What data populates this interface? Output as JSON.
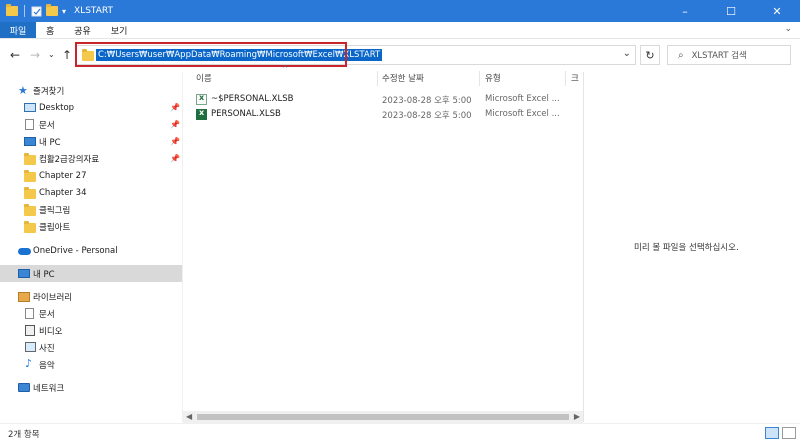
{
  "window": {
    "title": "XLSTART",
    "minimize": "–",
    "maximize": "☐",
    "close": "✕"
  },
  "ribbon": {
    "tabs": [
      "파일",
      "홈",
      "공유",
      "보기"
    ],
    "expand": "⌄"
  },
  "address": {
    "path": "C:₩Users₩user₩AppData₩Roaming₩Microsoft₩Excel₩XLSTART",
    "dropdown": "⌄",
    "refresh": "↻",
    "back": "←",
    "forward": "→",
    "recent": "⌄",
    "up": "↑"
  },
  "search": {
    "icon": "⌕",
    "placeholder": "XLSTART 검색"
  },
  "nav": {
    "quick_access": "즐겨찾기",
    "items_quick": [
      {
        "label": "Desktop",
        "icon": "desktop-icon",
        "pinned": true
      },
      {
        "label": "문서",
        "icon": "document-icon",
        "pinned": true
      },
      {
        "label": "내 PC",
        "icon": "pc-icon",
        "pinned": true
      },
      {
        "label": "컴활2급강의자료",
        "icon": "folder-icon",
        "pinned": true
      },
      {
        "label": "Chapter 27",
        "icon": "folder-icon",
        "pinned": false
      },
      {
        "label": "Chapter 34",
        "icon": "folder-icon",
        "pinned": false
      },
      {
        "label": "클릭그림",
        "icon": "folder-icon",
        "pinned": false
      },
      {
        "label": "클립아트",
        "icon": "folder-icon",
        "pinned": false
      }
    ],
    "onedrive": "OneDrive - Personal",
    "this_pc": "내 PC",
    "library": "라이브러리",
    "library_items": [
      "문서",
      "비디오",
      "사진",
      "음악"
    ],
    "network": "네트워크",
    "pin_glyph": "📌"
  },
  "columns": {
    "name": "이름",
    "modified": "수정한 날짜",
    "type": "유형",
    "size": "크",
    "sort_indicator": "^"
  },
  "files": [
    {
      "name": "~$PERSONAL.XLSB",
      "modified": "2023-08-28 오후 5:00",
      "type": "Microsoft Excel ..."
    },
    {
      "name": "PERSONAL.XLSB",
      "modified": "2023-08-28 오후 5:00",
      "type": "Microsoft Excel ..."
    }
  ],
  "preview": {
    "message": "미리 볼 파일을 선택하십시오."
  },
  "scroll": {
    "left": "◀",
    "right": "▶"
  },
  "status": {
    "count": "2개 항목"
  },
  "colors": {
    "titlebar": "#2a78d7",
    "file_tab": "#1f6fc5",
    "address_selection": "#0a66c9",
    "highlight_box": "#c7242b",
    "selected_nav": "#d9d9d9"
  }
}
